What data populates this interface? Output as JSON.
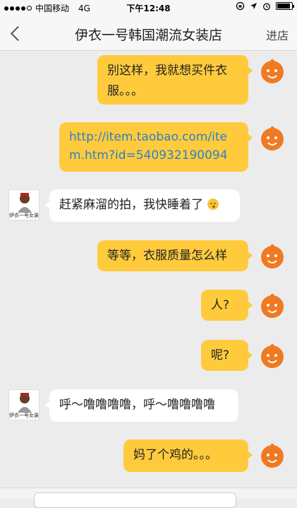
{
  "status_bar": {
    "carrier": "中国移动",
    "network": "4G",
    "time": "下午12:48",
    "battery_level": 0.9
  },
  "header": {
    "back_icon": "chevron-left-icon",
    "title": "伊衣一号韩国潮流女装店",
    "action_label": "进店"
  },
  "messages": [
    {
      "side": "out",
      "text": "别这样，我就想买件衣服。。。"
    },
    {
      "side": "out",
      "text": "http://item.taobao.com/item.htm?id=540932190094"
    },
    {
      "side": "in",
      "text": "赶紧麻溜的拍，我快睡着了"
    },
    {
      "side": "out",
      "text": "等等，衣服质量怎么样"
    },
    {
      "side": "out",
      "text": "人?"
    },
    {
      "side": "out",
      "text": "呢?"
    },
    {
      "side": "in",
      "text": "呼～噜噜噜噜，呼～噜噜噜噜"
    },
    {
      "side": "out",
      "text": "妈了个鸡的。。。"
    }
  ],
  "shop_avatar_caption": "伊衣一号女装",
  "colors": {
    "outgoing_bubble": "#ffcb3d",
    "incoming_bubble": "#ffffff",
    "link": "#2f7fc6",
    "background": "#ececec"
  }
}
